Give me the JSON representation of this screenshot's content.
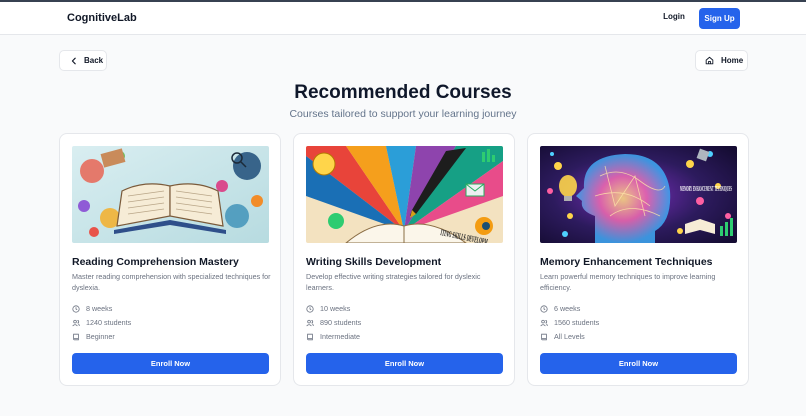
{
  "header": {
    "logo": "CognitiveLab",
    "login_label": "Login",
    "signup_label": "Sign Up"
  },
  "nav": {
    "back_label": "Back",
    "home_label": "Home"
  },
  "page": {
    "title": "Recommended Courses",
    "subtitle": "Courses tailored to support your learning journey"
  },
  "courses": [
    {
      "title": "Reading Comprehension Mastery",
      "description": "Master reading comprehension with specialized techniques for dyslexia.",
      "duration": "8 weeks",
      "students": "1240 students",
      "level": "Beginner",
      "enroll_label": "Enroll Now",
      "image": "open-book-illustration"
    },
    {
      "title": "Writing Skills Development",
      "description": "Develop effective writing strategies tailored for dyslexic learners.",
      "duration": "10 weeks",
      "students": "890 students",
      "level": "Intermediate",
      "enroll_label": "Enroll Now",
      "image": "fountain-pen-illustration",
      "image_text": "ITING SKILLS DEVELOPM"
    },
    {
      "title": "Memory Enhancement Techniques",
      "description": "Learn powerful memory techniques to improve learning efficiency.",
      "duration": "6 weeks",
      "students": "1560 students",
      "level": "All Levels",
      "enroll_label": "Enroll Now",
      "image": "neural-brain-illustration",
      "image_text": "MEMORY ENHANCEMENT TECHNIQUES"
    }
  ],
  "colors": {
    "primary": "#2563eb",
    "text": "#111827",
    "muted": "#6b7280",
    "border": "#e5e7eb"
  },
  "icons": [
    "arrow-left-icon",
    "home-icon",
    "clock-icon",
    "users-icon",
    "book-icon"
  ]
}
